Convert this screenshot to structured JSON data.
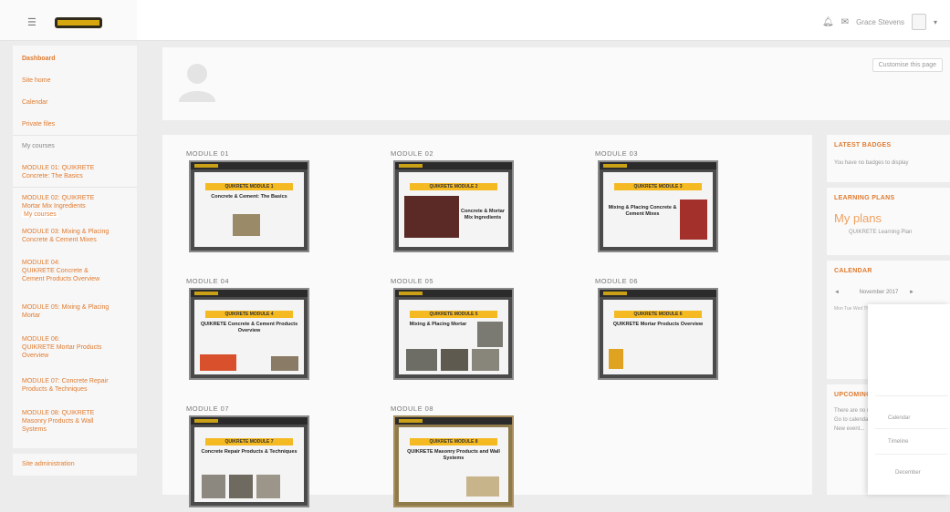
{
  "topbar": {
    "menu_icon": "hamburger-icon",
    "logo_text": "QUIKRETE",
    "right": {
      "notifications_icon": "bell-icon",
      "messages_icon": "chat-icon",
      "user_name": "Grace Stevens",
      "avatar_icon": "user-avatar-icon",
      "caret_icon": "chevron-down-icon"
    }
  },
  "leftnav": {
    "items": [
      {
        "label": "Dashboard",
        "style": "bold"
      },
      {
        "label": "Site home",
        "style": "link"
      },
      {
        "label": "Calendar",
        "style": "link"
      },
      {
        "label": "Private files",
        "style": "link"
      },
      {
        "label": "My courses",
        "style": "gray"
      },
      {
        "label": "MODULE 01: QUIKRETE",
        "style": "link"
      },
      {
        "label": "Concrete: The Basics",
        "style": "link"
      },
      {
        "label": "MODULE 02: QUIKRETE",
        "style": "link"
      },
      {
        "label": "Mortar Mix Ingredients",
        "style": "link"
      },
      {
        "label": "MODULE 03: Mixing & Placing",
        "style": "link"
      },
      {
        "label": "Concrete & Cement Mixes",
        "style": "link"
      },
      {
        "label": "MODULE 04:",
        "style": "link"
      },
      {
        "label": "QUIKRETE Concrete &",
        "style": "link"
      },
      {
        "label": "Cement Products Overview",
        "style": "link"
      },
      {
        "label": "MODULE 05: Mixing & Placing",
        "style": "link"
      },
      {
        "label": "Mortar",
        "style": "link"
      },
      {
        "label": "MODULE 06:",
        "style": "link"
      },
      {
        "label": "QUIKRETE Mortar Products",
        "style": "link"
      },
      {
        "label": "Overview",
        "style": "link"
      },
      {
        "label": "MODULE 07: Concrete Repair",
        "style": "link"
      },
      {
        "label": "Products & Techniques",
        "style": "link"
      },
      {
        "label": "MODULE 08: QUIKRETE",
        "style": "link"
      },
      {
        "label": "Masonry Products & Wall",
        "style": "link"
      },
      {
        "label": "Systems",
        "style": "link"
      }
    ],
    "tooltip": "My courses",
    "bottom_link": "Site administration"
  },
  "header": {
    "profile_icon": "user-silhouette-icon",
    "customise_button": "Customise this page"
  },
  "modules": [
    {
      "label": "MODULE 01",
      "slide_bar": "QUIKRETE MODULE 1",
      "slide_title": "Concrete & Cement: The Basics"
    },
    {
      "label": "MODULE 02",
      "slide_bar": "QUIKRETE MODULE 2",
      "slide_title": "Concrete & Mortar Mix Ingredients"
    },
    {
      "label": "MODULE 03",
      "slide_bar": "QUIKRETE MODULE 3",
      "slide_title": "Mixing & Placing Concrete & Cement Mixes"
    },
    {
      "label": "MODULE 04",
      "slide_bar": "QUIKRETE MODULE 4",
      "slide_title": "QUIKRETE Concrete & Cement Products Overview"
    },
    {
      "label": "MODULE 05",
      "slide_bar": "QUIKRETE MODULE 5",
      "slide_title": "Mixing & Placing Mortar"
    },
    {
      "label": "MODULE 06",
      "slide_bar": "QUIKRETE MODULE 6",
      "slide_title": "QUIKRETE Mortar Products Overview"
    },
    {
      "label": "MODULE 07",
      "slide_bar": "QUIKRETE MODULE 7",
      "slide_title": "Concrete Repair Products & Techniques"
    },
    {
      "label": "MODULE 08",
      "slide_bar": "QUIKRETE MODULE 8",
      "slide_title": "QUIKRETE Masonry Products and Wall Systems"
    }
  ],
  "right": {
    "badges_title": "LATEST BADGES",
    "badges_text": "You have no badges to display",
    "plans_title": "LEARNING PLANS",
    "plans_big": "My plans",
    "plans_item": "QUIKRETE Learning Plan",
    "calendar_title": "CALENDAR",
    "calendar_month": "November 2017",
    "calendar_prev": "◄",
    "calendar_next": "►",
    "calendar_days": "Mon Tue Wed Thu Fri Sat Sun",
    "upcoming_title": "UPCOMING EVENTS",
    "upcoming_text_1": "There are no upcoming events",
    "upcoming_text_2": "Go to calendar...",
    "upcoming_text_3": "New event..."
  },
  "popup": {
    "item_1": "Calendar",
    "item_2": "Timeline",
    "item_3": "December"
  }
}
